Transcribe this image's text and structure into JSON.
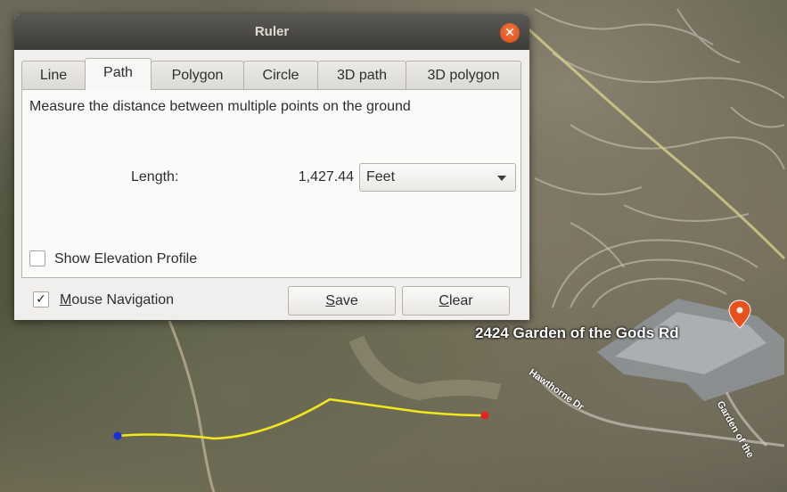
{
  "dialog": {
    "title": "Ruler",
    "tabs": [
      {
        "label": "Line"
      },
      {
        "label": "Path"
      },
      {
        "label": "Polygon"
      },
      {
        "label": "Circle"
      },
      {
        "label": "3D path"
      },
      {
        "label": "3D polygon"
      }
    ],
    "active_tab": "Path",
    "description": "Measure the distance between multiple points on the ground",
    "length_label": "Length:",
    "length_value": "1,427.44",
    "unit": "Feet",
    "show_elevation_label": "Show Elevation Profile",
    "show_elevation_checked": false,
    "mouse_nav_label_first": "M",
    "mouse_nav_label_rest": "ouse Navigation",
    "mouse_nav_checked": true,
    "save_first": "S",
    "save_rest": "ave",
    "clear_first": "C",
    "clear_rest": "lear"
  },
  "map": {
    "place_label": "2424 Garden of the Gods Rd",
    "road_label_1": "Hawthorne Dr",
    "road_label_2": "Garden of the",
    "path_color": "#f2e81a",
    "start_point_color": "#1a2fd8",
    "end_point_color": "#e8201e",
    "pin_color": "#e8501e"
  }
}
